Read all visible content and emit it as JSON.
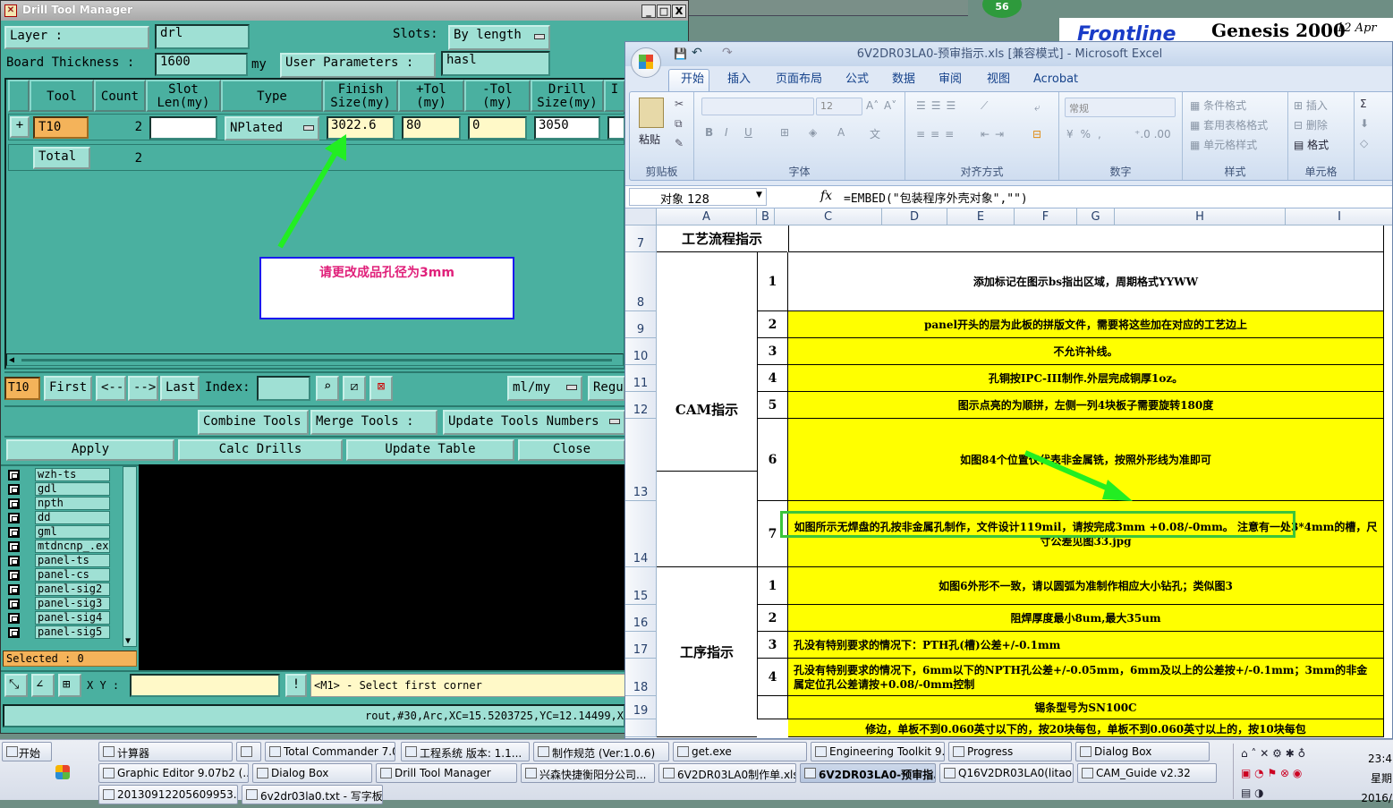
{
  "dtm": {
    "title": "Drill Tool Manager",
    "win_min": "_",
    "win_max": "□",
    "win_close": "X",
    "layer_label": "Layer          :",
    "layer_value": "drl",
    "slots_label": "Slots:",
    "slots_value": "By length",
    "board_thickness_label": "Board Thickness :",
    "board_thickness_value": "1600",
    "board_thickness_unit": "my",
    "user_params_label": "User Parameters :",
    "user_params_value": "hasl",
    "columns": [
      "",
      "Tool",
      "Count",
      "Slot Len(my)",
      "Type",
      "Finish Size(my)",
      "+Tol (my)",
      "-Tol (my)",
      "Drill Size(my)",
      "I"
    ],
    "row1": {
      "expand": "+",
      "tool": "T10",
      "count": "2",
      "slot_len": "",
      "type": "NPlated",
      "finish": "3022.6",
      "ptol": "80",
      "mtol": "0",
      "drill": "3050"
    },
    "total": {
      "label": "Total",
      "count": "2"
    },
    "annotation": "请更改成品孔径为3mm",
    "nav": {
      "tool": "T10",
      "first": "First",
      "prev": "<--",
      "next": "-->",
      "last": "Last",
      "index_label": "Index:",
      "unit": "ml/my",
      "regu": "Regu"
    },
    "actions": {
      "combine": "Combine Tools",
      "merge": "Merge Tools :",
      "update_numbers": "Update Tools Numbers"
    },
    "bottom": {
      "apply": "Apply",
      "calc": "Calc Drills",
      "update_table": "Update Table",
      "close": "Close"
    },
    "layers": [
      "wzh-ts",
      "gdl",
      "npth",
      "dd",
      "gml",
      "mtdncnp_.exe",
      "panel-ts",
      "panel-cs",
      "panel-sig2",
      "panel-sig3",
      "panel-sig4",
      "panel-sig5"
    ],
    "selected": "Selected : 0",
    "xy_label": "X Y :",
    "status_hint": "<M1> - Select first corner",
    "command": "rout,#30,Arc,XC=15.5203725,YC=12.14499,X"
  },
  "genesis": {
    "badge": "56",
    "logo": "Frontline",
    "title": "Genesis 2000",
    "date": "12 Apr"
  },
  "excel": {
    "title": "6V2DR03LA0-预审指示.xls  [兼容模式] - Microsoft Excel",
    "tabs": [
      "开始",
      "插入",
      "页面布局",
      "公式",
      "数据",
      "审阅",
      "视图",
      "Acrobat"
    ],
    "ribbon": {
      "paste": "粘贴",
      "clipboard": "剪贴板",
      "font_group": "字体",
      "font_size": "12",
      "align_group": "对齐方式",
      "number_format": "常规",
      "number_group": "数字",
      "cond_format": "条件格式",
      "table_format": "套用表格格式",
      "cell_style": "单元格样式",
      "style_group": "样式",
      "insert": "插入",
      "delete": "删除",
      "format": "格式",
      "cells_group": "单元格",
      "bold": "B",
      "italic": "I",
      "underline": "U"
    },
    "name_box": "对象 128",
    "fx": "fx",
    "formula": "=EMBED(\"包装程序外壳对象\",\"\")",
    "columns": [
      "A",
      "B",
      "C",
      "D",
      "E",
      "F",
      "G",
      "H",
      "I"
    ],
    "rows": [
      {
        "num": "7",
        "b": "",
        "text": "工艺流程指示",
        "yellow": false
      },
      {
        "num": "8",
        "b": "1",
        "text": "添加标记在图示bs指出区域，周期格式YYWW",
        "yellow": false
      },
      {
        "num": "9",
        "b": "2",
        "text": "panel开头的层为此板的拼版文件，需要将这些加在对应的工艺边上",
        "yellow": true
      },
      {
        "num": "10",
        "b": "3",
        "text": "不允许补线。",
        "yellow": true
      },
      {
        "num": "11",
        "b": "4",
        "text": "孔铜按IPC-III制作.外层完成铜厚1oz。",
        "yellow": true
      },
      {
        "num": "12",
        "b": "5",
        "text": "图示点亮的为顺拼，左侧一列4块板子需要旋转180度",
        "yellow": true
      },
      {
        "num": "13",
        "b": "6",
        "text": "如图84个位置仅代表非金属铣，按照外形线为准即可",
        "yellow": true
      },
      {
        "num": "14",
        "b": "7",
        "text": "如图所示无焊盘的孔按非金属孔制作，文件设计119mil，请按完成3mm +0.08/-0mm。 注意有一处3*4mm的槽，尺寸公差见图33.jpg",
        "yellow": true
      },
      {
        "num": "15",
        "b": "1",
        "text": "如图6外形不一致，请以圆弧为准制作相应大小钻孔；类似图3",
        "yellow": true
      },
      {
        "num": "16",
        "b": "2",
        "text": "阻焊厚度最小8um,最大35um",
        "yellow": true
      },
      {
        "num": "17",
        "b": "3",
        "text": "孔没有特别要求的情况下：PTH孔(槽)公差+/-0.1mm",
        "yellow": true
      },
      {
        "num": "18",
        "b": "4",
        "text": "孔没有特别要求的情况下，6mm以下的NPTH孔公差+/-0.05mm，6mm及以上的公差按+/-0.1mm；3mm的非金属定位孔公差请按+0.08/-0mm控制",
        "yellow": true
      },
      {
        "num": "19",
        "b": "",
        "text": "锡条型号为SN100C",
        "yellow": true
      }
    ],
    "group_cam": "CAM指示",
    "group_proc": "工序指示",
    "row20_text": "修边，单板不到0.060英寸以下的，按20块每包，单板不到0.060英寸以上的，按10块每包"
  },
  "taskbar": {
    "start": "开始",
    "row1": [
      "计算器",
      "",
      "Total Commander 7.0 ...",
      "工程系统 版本: 1.1...",
      "制作规范 (Ver:1.0.6)",
      "get.exe",
      "Engineering Toolkit 9.0...",
      "Progress",
      "Dialog Box"
    ],
    "row2": [
      "Graphic Editor 9.07b2 (...",
      "Dialog Box",
      "Drill Tool Manager",
      "兴森快捷衡阳分公司...",
      "6V2DR03LA0制作单.xls...",
      "6V2DR03LA0-预审指...",
      "Q16V2DR03LA0(litao)20...",
      "CAM_Guide v2.32"
    ],
    "row3": [
      "20130912205609953.rtf...",
      "6v2dr03la0.txt - 写字板"
    ],
    "clock": "23:4",
    "weekday": "星期",
    "date": "2016/"
  }
}
